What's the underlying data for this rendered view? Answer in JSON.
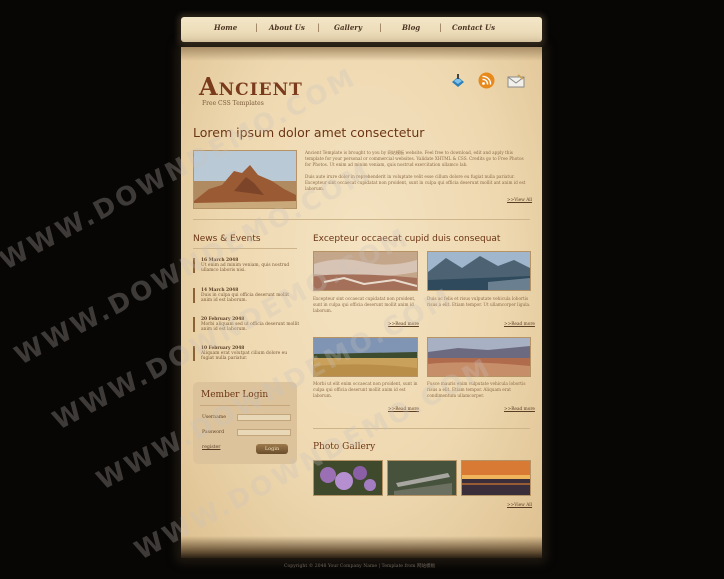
{
  "nav": {
    "items": [
      "Home",
      "About Us",
      "Gallery",
      "Blog",
      "Contact Us"
    ],
    "separator": "|"
  },
  "header": {
    "logo": "Ancient",
    "tagline": "Free CSS Templates",
    "icons": [
      "delicious-icon",
      "rss-icon",
      "email-icon"
    ]
  },
  "intro": {
    "heading": "Lorem ipsum dolor amet consectetur",
    "para1": "Ancient Template is brought to you by 网站模板 website. Feel free to download, edit and apply this template for your personal or commercial websites. Validate XHTML & CSS. Credits go to Free Photos for Photos. Ut enim ad minim veniam, quis nostrud exercitation ullamco lab.",
    "para2": "Duis aute irure dolor in reprehenderit in voluptate velit esse cillum dolore eu fugiat nulla pariatur. Excepteur sint occaecat cupidatat non proident, sunt in culpa qui officia deserunt mollit ant anim id est laborum.",
    "view_all": ">>View All"
  },
  "news": {
    "heading": "News & Events",
    "items": [
      {
        "date": "16 March 2048",
        "text": "Ut enim ad minim veniam, quis nostrud ullamco laboris nisi."
      },
      {
        "date": "14 March 2048",
        "text": "Duis in culpa qui officia deserunt mollit anim id est laborum."
      },
      {
        "date": "20 February 2048",
        "text": "Morbi aliquam sed ut officia deserunt mollit anim id est laborum."
      },
      {
        "date": "10 February 2048",
        "text": "Aliquam erat volutpat cilium dolore eu fugiat nulla pariatur."
      }
    ]
  },
  "login": {
    "heading": "Member Login",
    "username_label": "Username",
    "password_label": "Password",
    "register": "register",
    "button": "Login"
  },
  "excepteur": {
    "heading": "Excepteur occaecat cupid duis consequat",
    "cards": [
      {
        "text": "Excepteur sint occaecat cupidatat non proident, sunt in culpa qui officia deserunt mollit anim id laborum.",
        "more": ">>Read more"
      },
      {
        "text": "Duis ac felis et risus vulputate vehicula lobortis risus a elit. Etiam tempor. Ut ullamcorper ligula.",
        "more": ">>Read more"
      },
      {
        "text": "Morbi ut elit enim occaecat non proident, sunt in culpa qui officia deserunt mollit anim id est laborum.",
        "more": ">>Read more"
      },
      {
        "text": "Fusce mauris enim vulputate vehicula lobortis risus a elit. Etiam tempor. Aliquam erat condimentum ullamcorper.",
        "more": ">>Read more"
      }
    ]
  },
  "gallery": {
    "heading": "Photo Gallery",
    "view_all": ">>View All"
  },
  "footer": {
    "text": "Copyright © 2048 Your Company Name | Template from 网站模板"
  },
  "watermark": "WWW.DOWNDEMO.COM",
  "colors": {
    "background": "#070605",
    "parchment": "#eed8b0",
    "heading": "#6b3515",
    "logo": "#7a3a1c"
  }
}
